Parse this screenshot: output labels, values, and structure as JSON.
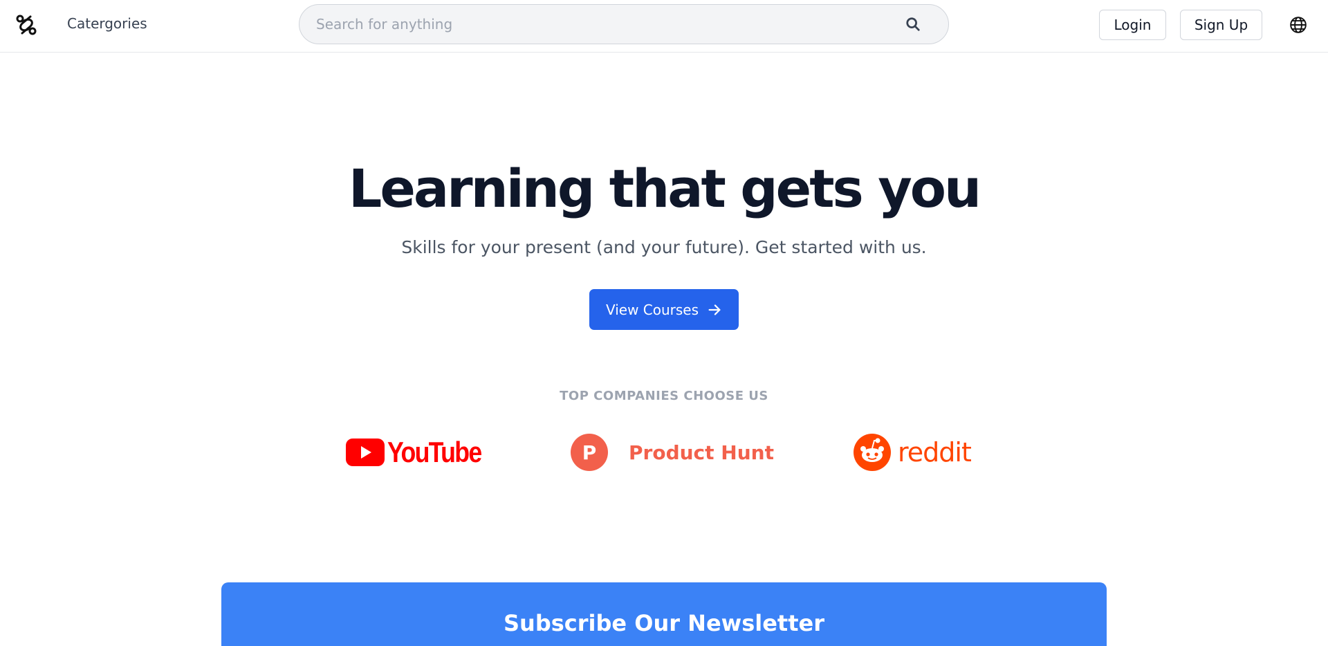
{
  "header": {
    "logo_icon": "link-logo-icon",
    "categories_label": "Catergories",
    "search_placeholder": "Search for anything",
    "search_icon": "search-icon",
    "login_label": "Login",
    "signup_label": "Sign Up",
    "language_icon": "globe-icon"
  },
  "hero": {
    "title": "Learning that gets you",
    "subtitle": "Skills for your present (and your future). Get started with us.",
    "cta_label": "View Courses",
    "cta_icon": "arrow-right-icon"
  },
  "companies": {
    "label": "TOP COMPANIES CHOOSE US",
    "logos": [
      {
        "name": "YouTube",
        "icon": "youtube-logo-icon",
        "color": "#ff0000"
      },
      {
        "name": "Product Hunt",
        "icon": "product-hunt-logo-icon",
        "color": "#da552f"
      },
      {
        "name": "reddit",
        "icon": "reddit-logo-icon",
        "color": "#ff4500"
      }
    ]
  },
  "newsletter": {
    "title": "Subscribe Our Newsletter"
  },
  "colors": {
    "primary": "#2563eb",
    "newsletter_bg": "#3b82f6",
    "title_text": "#0f172a",
    "muted_text": "#9ca3af"
  }
}
